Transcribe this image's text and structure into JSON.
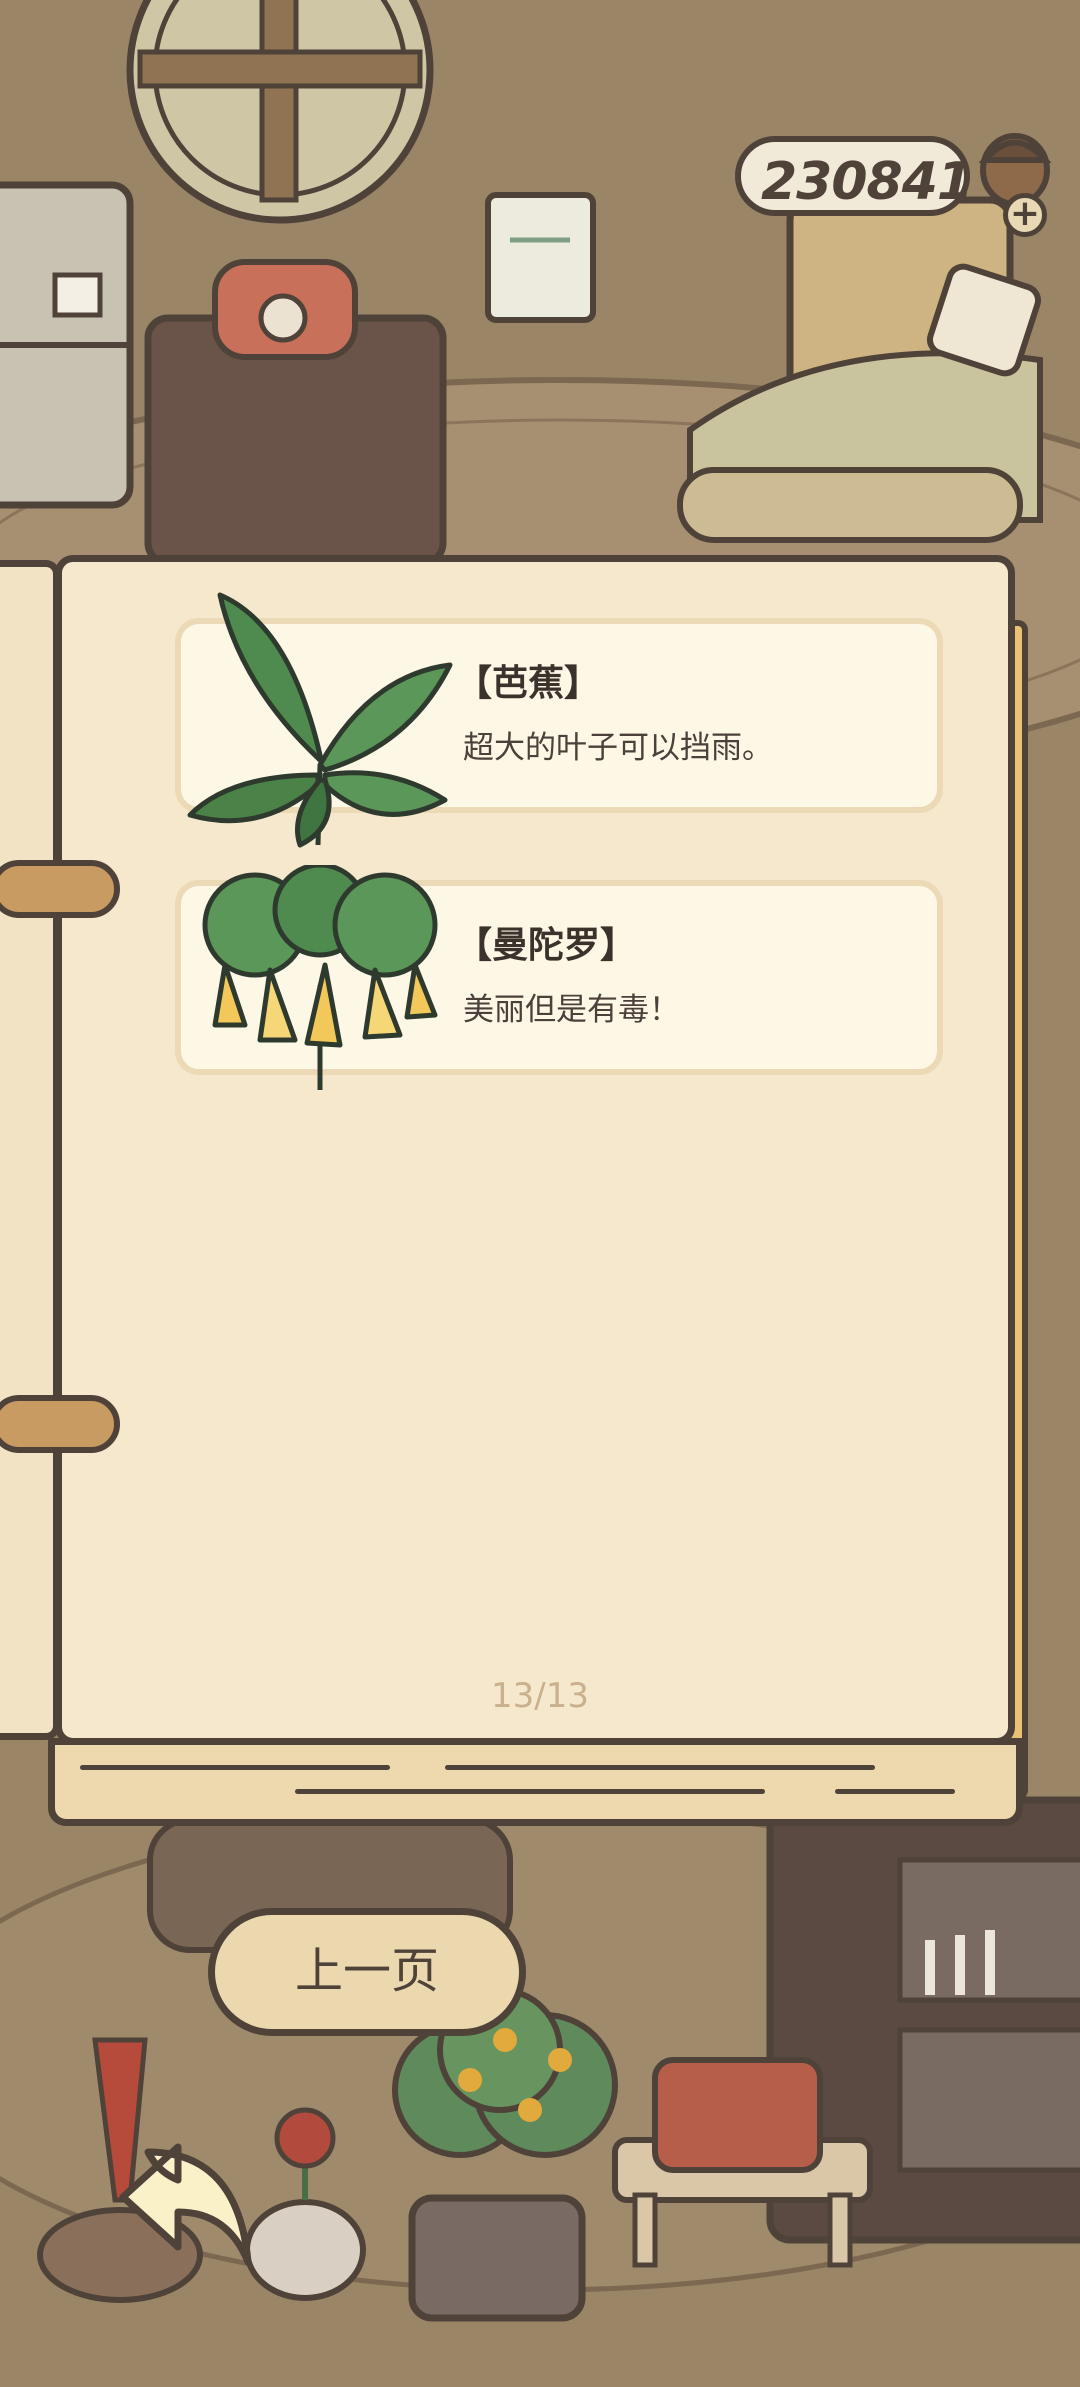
{
  "header": {
    "coin_count": "230841",
    "add_coins_label": "+"
  },
  "book": {
    "entries": [
      {
        "name": "【芭蕉】",
        "description": "超大的叶子可以挡雨。",
        "icon": "banana-plant-icon"
      },
      {
        "name": "【曼陀罗】",
        "description": "美丽但是有毒！",
        "icon": "datura-plant-icon"
      }
    ],
    "page_indicator": "13/13"
  },
  "navigation": {
    "prev_page_label": "上一页",
    "back_icon": "back-arrow-icon"
  },
  "colors": {
    "outline": "#4f4239",
    "page": "#f6e8cc",
    "card": "#fdf7e6",
    "button": "#ecd8ae",
    "room": "#a08a6c"
  }
}
